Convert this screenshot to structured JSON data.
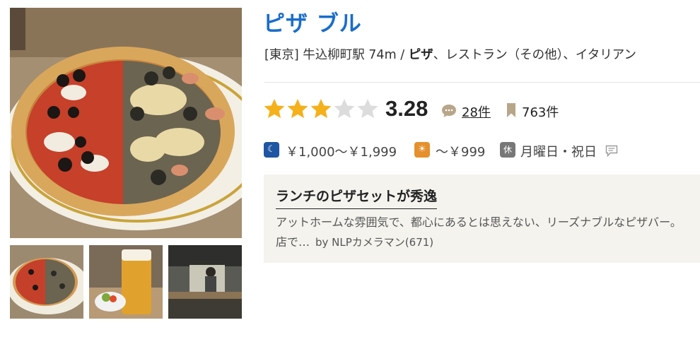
{
  "restaurant": {
    "name": "ピザ ブル",
    "area": "[東京]",
    "station": "牛込柳町駅 74m",
    "separator": "/",
    "genre_bold": "ピザ",
    "genre_rest": "、レストラン（その他）、イタリアン"
  },
  "rating": {
    "filled_stars": 3,
    "total_stars": 5,
    "score": "3.28",
    "review_count": "28件",
    "bookmark_count": "763件",
    "star_color": "#f5b11c",
    "empty_star_color": "#dcdcdc"
  },
  "price": {
    "dinner_badge": "☾",
    "dinner": "￥1,000～￥1,999",
    "lunch_badge": "☀",
    "lunch": "～￥999",
    "holiday_badge": "休",
    "holiday": "月曜日・祝日"
  },
  "review": {
    "title": "ランチのピザセットが秀逸",
    "body": "アットホームな雰囲気で、都心にあるとは思えない、リーズナブルなピザバー。",
    "body_line2": "店で…",
    "author": "by NLPカメラマン(671)"
  },
  "icons": {
    "review_icon": "speech-bubble-icon",
    "bookmark_icon": "bookmark-icon",
    "note_icon": "comment-note-icon"
  },
  "colors": {
    "title": "#1a6dcb",
    "dinner_badge": "#1f55a2",
    "lunch_badge": "#e5902c",
    "holiday_badge": "#777777",
    "review_box_bg": "#f4f3ee"
  }
}
